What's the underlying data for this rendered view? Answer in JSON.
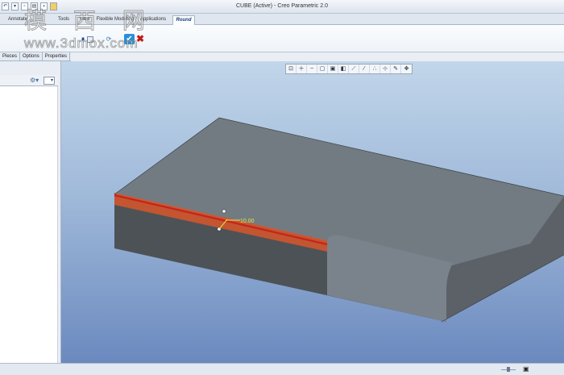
{
  "window": {
    "title": "CUBE (Active) - Creo Parametric 2.0"
  },
  "quick_access": {
    "icons": [
      "undo-icon",
      "dropdown-icon",
      "new-icon",
      "open-icon",
      "save-icon",
      "folder-icon"
    ]
  },
  "ribbon": {
    "tabs": [
      {
        "label": "Annotate"
      },
      {
        "label": "Tools"
      },
      {
        "label": "View"
      },
      {
        "label": "Flexible Modeling"
      },
      {
        "label": "Applications"
      },
      {
        "label": "Round"
      }
    ],
    "active_tab": "Round",
    "buttons": {
      "pause": "⏸",
      "verify": "⟳",
      "ok": "✔",
      "cancel": "✖"
    }
  },
  "watermark": {
    "chinese": "模 西 网",
    "url": "www.3dmox.com"
  },
  "dashboard_tabs": [
    {
      "label": "Pieces"
    },
    {
      "label": "Options"
    },
    {
      "label": "Properties"
    }
  ],
  "view_toolbar": {
    "icons": [
      "refit-icon",
      "zoom-in-icon",
      "zoom-out-icon",
      "repaint-icon",
      "saved-views-icon",
      "display-style-icon",
      "datum-plane-icon",
      "datum-axis-icon",
      "datum-point-icon",
      "csys-icon",
      "annotation-icon",
      "spin-center-icon"
    ]
  },
  "model": {
    "round_radius": "10.00",
    "colors": {
      "top_face": "#727b82",
      "front_face": "#4d5257",
      "side_face": "#5c6167",
      "edge_highlight": "#c8231b",
      "round_preview": "#d8562a",
      "dimension": "#e8e040"
    }
  }
}
